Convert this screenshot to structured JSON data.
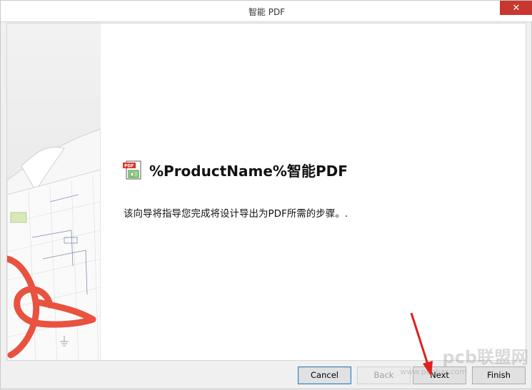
{
  "window": {
    "title": "智能 PDF",
    "close_glyph": "✕"
  },
  "main": {
    "heading": "%ProductName%智能PDF",
    "description": "该向导将指导您完成将设计导出为PDF所需的步骤。."
  },
  "buttons": {
    "cancel": "Cancel",
    "back": "Back",
    "next": "Next",
    "finish": "Finish"
  },
  "watermark": {
    "brand": "pcb联盟网",
    "url": "www.pcbbar.com"
  },
  "icons": {
    "pdf": "pdf-file-icon",
    "close": "close-icon",
    "arrow": "red-arrow-annotation"
  },
  "colors": {
    "close_button": "#c7372f",
    "acrobat_red": "#e8523f",
    "annotation_arrow": "#e0201b"
  }
}
